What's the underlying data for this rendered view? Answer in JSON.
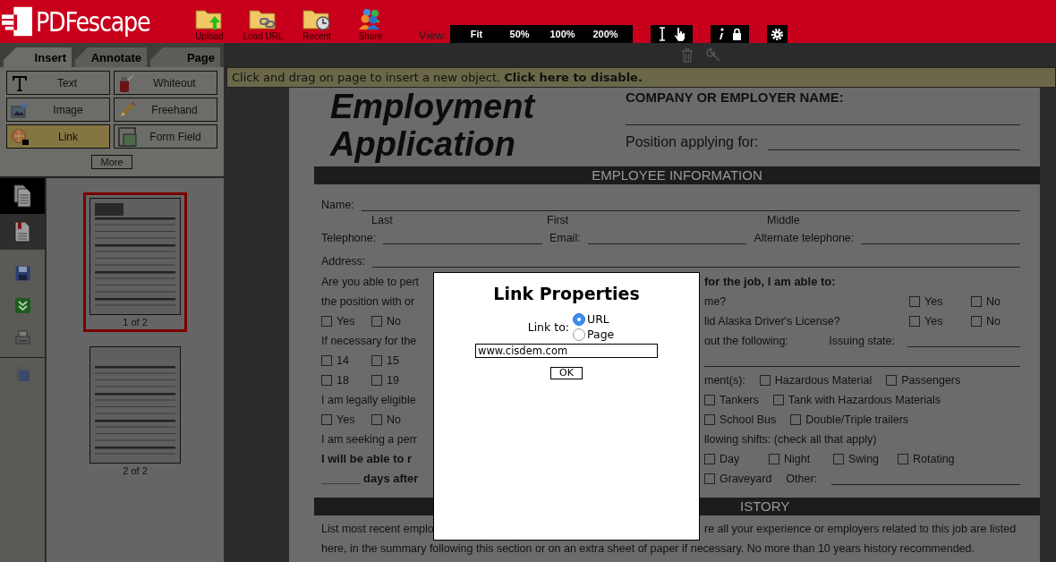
{
  "app": {
    "logo": "PDFescape"
  },
  "toolbar": [
    {
      "kind": "upload",
      "label": "Upload"
    },
    {
      "kind": "url",
      "label": "Load URL"
    },
    {
      "kind": "recent",
      "label": "Recent"
    },
    {
      "kind": "share",
      "label": "Share"
    }
  ],
  "view": {
    "label": "View:",
    "zooms": [
      "Fit",
      "50%",
      "100%",
      "200%"
    ]
  },
  "left_panel": {
    "tabs": [
      {
        "label": "Insert",
        "selected": true
      },
      {
        "label": "Annotate",
        "selected": false
      },
      {
        "label": "Page",
        "selected": false
      }
    ],
    "tools": [
      {
        "kind": "text",
        "label": "Text",
        "selected": false
      },
      {
        "kind": "whiteout",
        "label": "Whiteout",
        "selected": false
      },
      {
        "kind": "image",
        "label": "Image",
        "selected": false
      },
      {
        "kind": "freehand",
        "label": "Freehand",
        "selected": false
      },
      {
        "kind": "link",
        "label": "Link",
        "selected": true
      },
      {
        "kind": "formfield",
        "label": "Form Field",
        "selected": false
      }
    ],
    "more": "More",
    "views": [
      {
        "kind": "pages",
        "selected": true
      },
      {
        "kind": "bookmarks",
        "selected": false
      }
    ],
    "actions": [
      {
        "kind": "save"
      },
      {
        "kind": "download"
      },
      {
        "kind": "print"
      }
    ],
    "pages": [
      {
        "label": "1 of 2",
        "selected": true
      },
      {
        "label": "2 of 2",
        "selected": false
      }
    ]
  },
  "hint": {
    "text": "Click and drag on page to insert a new object.",
    "link": "Click here to disable."
  },
  "document": {
    "title_lines": [
      "Employment",
      "Application"
    ],
    "company_label": "COMPANY OR EMPLOYER NAME:",
    "position_label": "Position applying for:",
    "rows": [
      {
        "kind": "section",
        "text": "EMPLOYEE INFORMATION"
      },
      {
        "kind": "full",
        "items": [
          {
            "kind": "text",
            "text": "Name:"
          },
          {
            "kind": "blank"
          }
        ]
      },
      {
        "kind": "captions",
        "items": [
          {
            "kind": "text",
            "text": "Last"
          },
          {
            "kind": "text",
            "text": "First"
          },
          {
            "kind": "text",
            "text": "Middle"
          }
        ]
      },
      {
        "kind": "full",
        "items": [
          {
            "kind": "text",
            "text": "Telephone:"
          },
          {
            "kind": "blank"
          },
          {
            "kind": "text",
            "text": "Email:"
          },
          {
            "kind": "blank"
          },
          {
            "kind": "text",
            "text": "Alternate telephone:"
          },
          {
            "kind": "blank"
          }
        ]
      },
      {
        "kind": "full",
        "items": [
          {
            "kind": "text",
            "text": "Address:"
          },
          {
            "kind": "blank"
          }
        ]
      },
      {
        "kind": "split",
        "left": [
          {
            "kind": "text",
            "text": "Are you able to pert"
          }
        ],
        "right": [
          {
            "kind": "bold",
            "text": "for the job, I am able to:"
          }
        ]
      },
      {
        "kind": "split",
        "left": [
          {
            "kind": "text",
            "text": "the position with or"
          }
        ],
        "right": [
          {
            "kind": "text",
            "text": "me?"
          }
        ],
        "far": [
          {
            "kind": "checkbox",
            "text": "Yes",
            "checked": false
          },
          {
            "kind": "checkbox",
            "text": "No",
            "checked": false
          }
        ]
      },
      {
        "kind": "split",
        "left": [
          {
            "kind": "checkbox",
            "text": "Yes",
            "checked": false
          },
          {
            "kind": "checkbox",
            "text": "No",
            "checked": false
          }
        ],
        "right": [
          {
            "kind": "text",
            "text": "lid Alaska Driver's License?"
          }
        ],
        "far": [
          {
            "kind": "checkbox",
            "text": "Yes",
            "checked": false
          },
          {
            "kind": "checkbox",
            "text": "No",
            "checked": false
          }
        ]
      },
      {
        "kind": "split",
        "left": [
          {
            "kind": "text",
            "text": "If necessary for the"
          }
        ],
        "right": [
          {
            "kind": "text",
            "text": "out the following:"
          }
        ],
        "far": [
          {
            "kind": "text",
            "text": "Issuing state:"
          },
          {
            "kind": "blank"
          }
        ]
      },
      {
        "kind": "split",
        "left": [
          {
            "kind": "checkbox",
            "text": "14",
            "checked": false
          },
          {
            "kind": "checkbox",
            "text": "15",
            "checked": false
          }
        ],
        "right": [
          {
            "kind": "blank"
          }
        ]
      },
      {
        "kind": "split",
        "left": [
          {
            "kind": "checkbox",
            "text": "18",
            "checked": false
          },
          {
            "kind": "checkbox",
            "text": "19",
            "checked": false
          }
        ],
        "right": [
          {
            "kind": "text",
            "text": "ment(s):"
          },
          {
            "kind": "checkbox",
            "text": "Hazardous Material",
            "checked": false
          },
          {
            "kind": "checkbox",
            "text": "Passengers",
            "checked": false
          }
        ]
      },
      {
        "kind": "split",
        "left": [
          {
            "kind": "text",
            "text": "I am legally eligible"
          }
        ],
        "right": [
          {
            "kind": "checkbox",
            "text": "Tankers",
            "checked": false
          },
          {
            "kind": "checkbox",
            "text": "Tank with Hazardous Materials",
            "checked": false
          }
        ]
      },
      {
        "kind": "split",
        "left": [
          {
            "kind": "checkbox",
            "text": "Yes",
            "checked": false
          },
          {
            "kind": "checkbox",
            "text": "No",
            "checked": false
          }
        ],
        "right": [
          {
            "kind": "checkbox",
            "text": "School Bus",
            "checked": false
          },
          {
            "kind": "checkbox",
            "text": "Double/Triple trailers",
            "checked": false
          }
        ]
      },
      {
        "kind": "split",
        "left": [
          {
            "kind": "text",
            "text": "I am seeking a perr"
          }
        ],
        "right": [
          {
            "kind": "text",
            "text": "llowing shifts: (check all that apply)"
          }
        ]
      },
      {
        "kind": "split",
        "left": [
          {
            "kind": "bold",
            "text": "I will be able to r"
          }
        ],
        "right": [
          {
            "kind": "checkbox",
            "text": "Day",
            "checked": false
          },
          {
            "kind": "checkbox",
            "text": "Night",
            "checked": false
          },
          {
            "kind": "checkbox",
            "text": "Swing",
            "checked": false
          },
          {
            "kind": "checkbox",
            "text": "Rotating",
            "checked": false
          }
        ]
      },
      {
        "kind": "split",
        "left": [
          {
            "kind": "bold",
            "text": "______ days after"
          }
        ],
        "right": [
          {
            "kind": "checkbox",
            "text": "Graveyard",
            "checked": false
          },
          {
            "kind": "text",
            "text": "Other:"
          },
          {
            "kind": "blank"
          }
        ]
      },
      {
        "kind": "split_section",
        "text": "ISTORY"
      },
      {
        "kind": "split",
        "left": [
          {
            "kind": "text",
            "text": "List most recent emplo"
          }
        ],
        "right": [
          {
            "kind": "text",
            "text": "re all your experience or employers related to this job are listed"
          }
        ]
      },
      {
        "kind": "full",
        "items": [
          {
            "kind": "text",
            "text": "here, in the summary following this section or on an extra sheet of paper if necessary. No more than 10 years history recommended."
          }
        ]
      }
    ]
  },
  "dialog": {
    "title": "Link Properties",
    "link_to_label": "Link to:",
    "options": [
      {
        "label": "URL",
        "selected": true
      },
      {
        "label": "Page",
        "selected": false
      }
    ],
    "url": "www.cisdem.com",
    "ok": "OK"
  }
}
